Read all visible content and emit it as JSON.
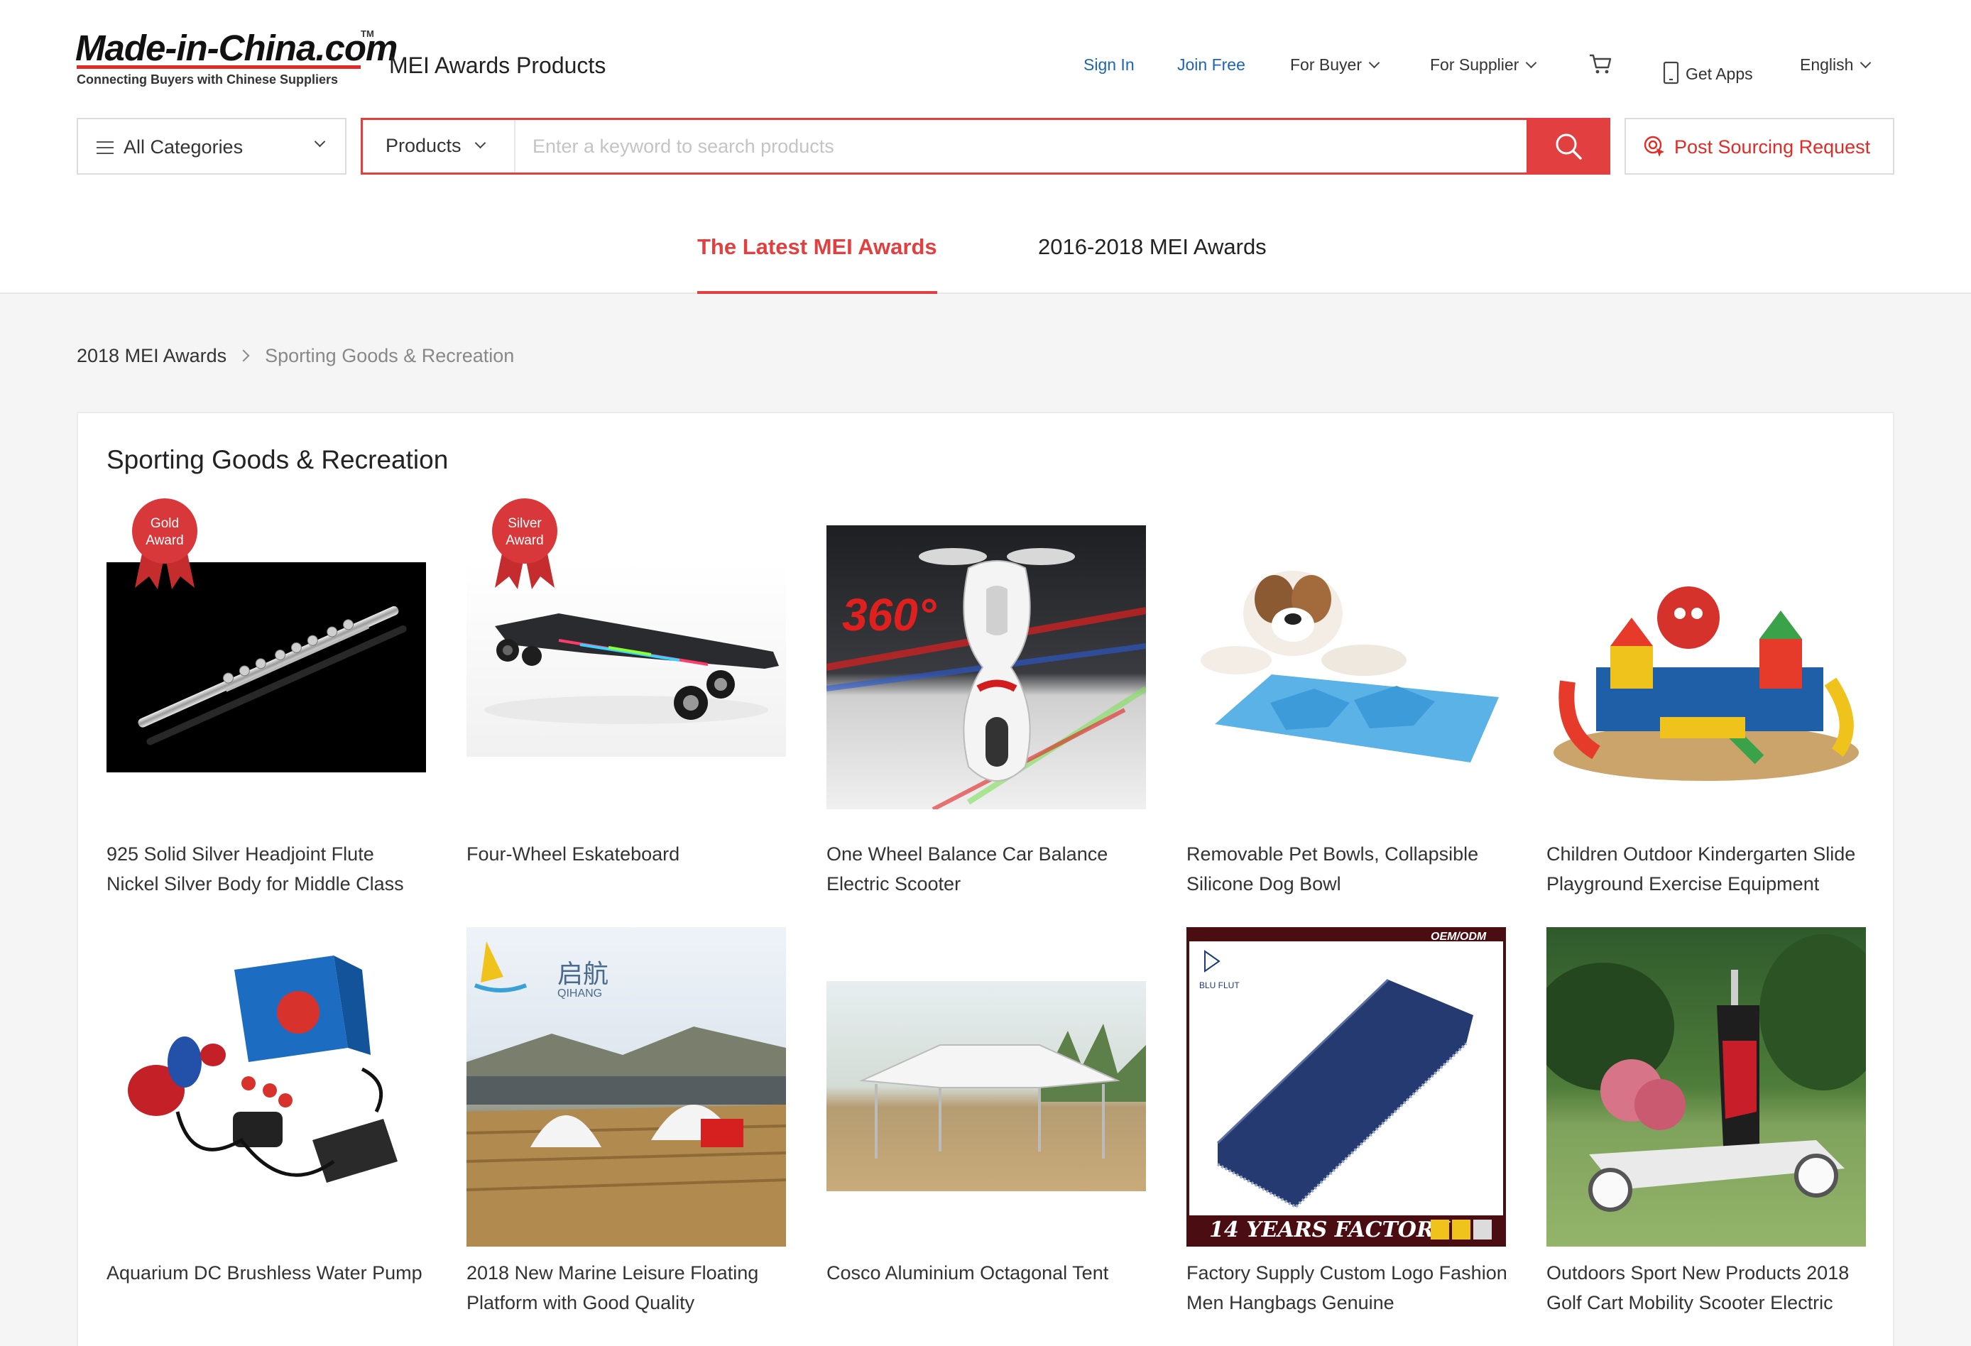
{
  "logo": {
    "main": "Made-in-China.com",
    "tm": "TM",
    "tagline": "Connecting Buyers with Chinese Suppliers"
  },
  "header": {
    "site_title": "MEI Awards Products",
    "sign_in": "Sign In",
    "join_free": "Join Free",
    "for_buyer": "For Buyer",
    "for_supplier": "For Supplier",
    "get_apps": "Get Apps",
    "language": "English"
  },
  "search": {
    "category": "All Categories",
    "type": "Products",
    "placeholder": "Enter a keyword to search products",
    "post_request": "Post Sourcing Request"
  },
  "tabs": [
    {
      "label": "The Latest MEI Awards",
      "active": true
    },
    {
      "label": "2016-2018 MEI Awards",
      "active": false
    }
  ],
  "breadcrumb": {
    "parent": "2018 MEI Awards",
    "current": "Sporting Goods & Recreation"
  },
  "section": {
    "title": "Sporting Goods & Recreation"
  },
  "products": [
    {
      "name": "925 Solid Silver Headjoint Flute Nickel Silver Body for Middle Class",
      "award": "Gold Award"
    },
    {
      "name": "Four-Wheel Eskateboard",
      "award": "Silver Award"
    },
    {
      "name": "One Wheel Balance Car Balance Electric Scooter",
      "image_text": "360°"
    },
    {
      "name": "Removable Pet Bowls, Collapsible Silicone Dog Bowl"
    },
    {
      "name": "Children Outdoor Kindergarten Slide Playground Exercise Equipment"
    },
    {
      "name": "Aquarium DC Brushless Water Pump"
    },
    {
      "name": "2018 New Marine Leisure Floating Platform with Good Quality",
      "image_text": "启航",
      "image_text_2": "QIHANG"
    },
    {
      "name": "Cosco Aluminium Octagonal Tent"
    },
    {
      "name": "Factory Supply Custom Logo Fashion Men Hangbags Genuine",
      "image_text": "OEM/ODM",
      "image_text_2": "BLU FLUT",
      "image_text_3": "14 YEARS FACTORY"
    },
    {
      "name": "Outdoors Sport New Products 2018 Golf Cart Mobility Scooter Electric"
    }
  ],
  "colors": {
    "accent": "#e24040",
    "link_blue": "#1d64b4",
    "award_red": "#d9383a"
  }
}
